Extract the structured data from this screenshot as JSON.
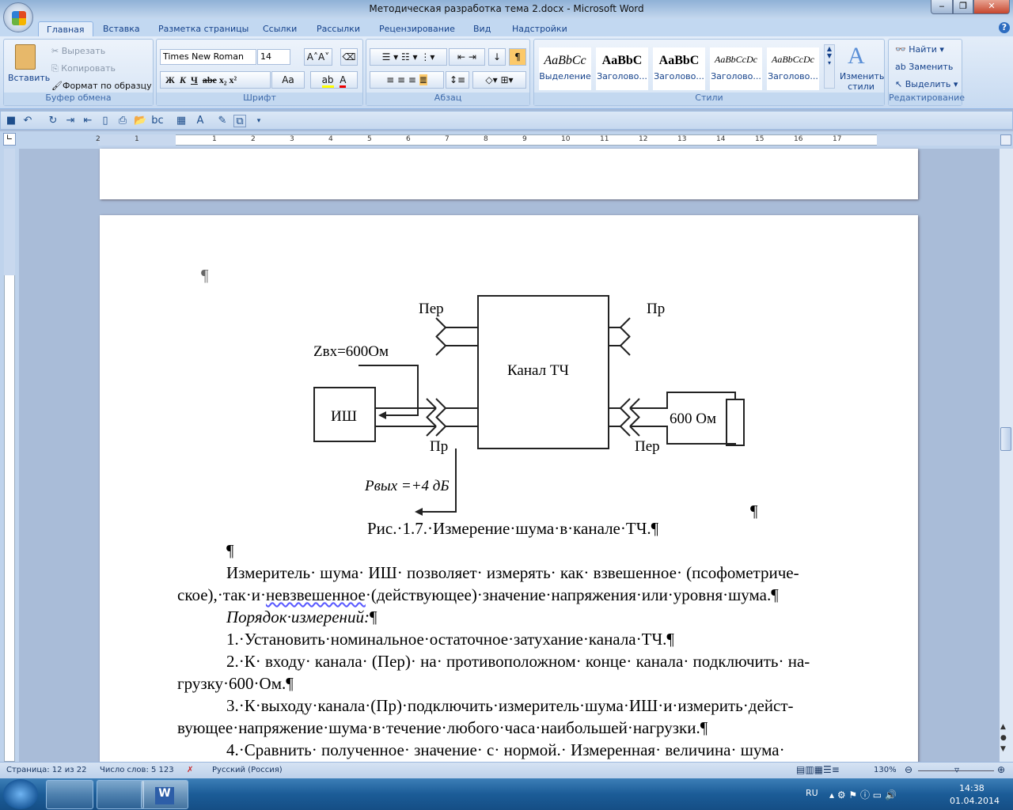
{
  "window": {
    "title": "Методическая разработка тема 2.docx - Microsoft Word"
  },
  "tabs": [
    "Главная",
    "Вставка",
    "Разметка страницы",
    "Ссылки",
    "Рассылки",
    "Рецензирование",
    "Вид",
    "Надстройки"
  ],
  "clipboard": {
    "paste": "Вставить",
    "cut": "Вырезать",
    "copy": "Копировать",
    "format_painter": "Формат по образцу",
    "label": "Буфер обмена"
  },
  "font": {
    "name": "Times New Roman",
    "size": "14",
    "label": "Шрифт",
    "bold": "Ж",
    "italic": "К",
    "underline": "Ч",
    "strike": "abe",
    "sub": "x₂",
    "sup": "x²",
    "case": "Aa"
  },
  "paragraph": {
    "label": "Абзац"
  },
  "styles": {
    "label": "Стили",
    "items": [
      {
        "sample": "AaBbCc",
        "name": "Выделение"
      },
      {
        "sample": "AaBbC",
        "name": "Заголово..."
      },
      {
        "sample": "AaBbC",
        "name": "Заголово..."
      },
      {
        "sample": "AaBbCcDc",
        "name": "Заголово..."
      },
      {
        "sample": "AaBbCcDc",
        "name": "Заголово..."
      }
    ],
    "change": "Изменить стили"
  },
  "editing": {
    "find": "Найти",
    "replace": "Заменить",
    "select": "Выделить",
    "label": "Редактирование"
  },
  "ruler": {
    "numbers": [
      "2",
      "1",
      "1",
      "2",
      "3",
      "4",
      "5",
      "6",
      "7",
      "8",
      "9",
      "10",
      "11",
      "12",
      "13",
      "14",
      "15",
      "16",
      "17"
    ]
  },
  "diagram": {
    "per_left": "Пер",
    "pr_right_top": "Пр",
    "zin": "Zвх=600Ом",
    "channel": "Канал  ТЧ",
    "meter": "ИШ",
    "pr_left": "Пр",
    "per_right": "Пер",
    "load": "600 Ом",
    "pout": "Pвых =+4 дБ"
  },
  "document": {
    "pilcrow": "¶",
    "caption": "Рис.·1.7.·Измерение·шума·в·канале·ТЧ.¶",
    "p1a": "Измеритель· шума· ИШ· позволяет· измерять· как· взвешенное· (псофометриче-",
    "p1b_pre": "ское),·так·и·",
    "p1b_spell": "невзвешенное",
    "p1b_post": "·(действующее)·значение·напряжения·или·уровня·шума.¶",
    "p2": "Порядок·измерений:",
    "p3": "1.·Установить·номинальное·остаточное·затухание·канала·ТЧ.¶",
    "p4a": "2.·К· входу· канала· (Пер)· на· противоположном· конце· канала· подключить· на-",
    "p4b": "грузку·600·Ом.¶",
    "p5a": "3.·К·выходу·канала·(Пр)·подключить·измеритель·шума·ИШ·и·измерить·дейст-",
    "p5b": "вующее·напряжение·шума·в·течение·любого·часа·наибольшей·нагрузки.¶",
    "p6": "4.·Сравнить·  полученное·  значение·  с·  нормой.·  Измеренная·  величина·  шума·"
  },
  "status": {
    "page": "Страница: 12 из 22",
    "words": "Число слов: 5 123",
    "lang": "Русский (Россия)",
    "zoom": "130%"
  },
  "taskbar": {
    "lang": "RU",
    "time": "14:38",
    "date": "01.04.2014"
  }
}
